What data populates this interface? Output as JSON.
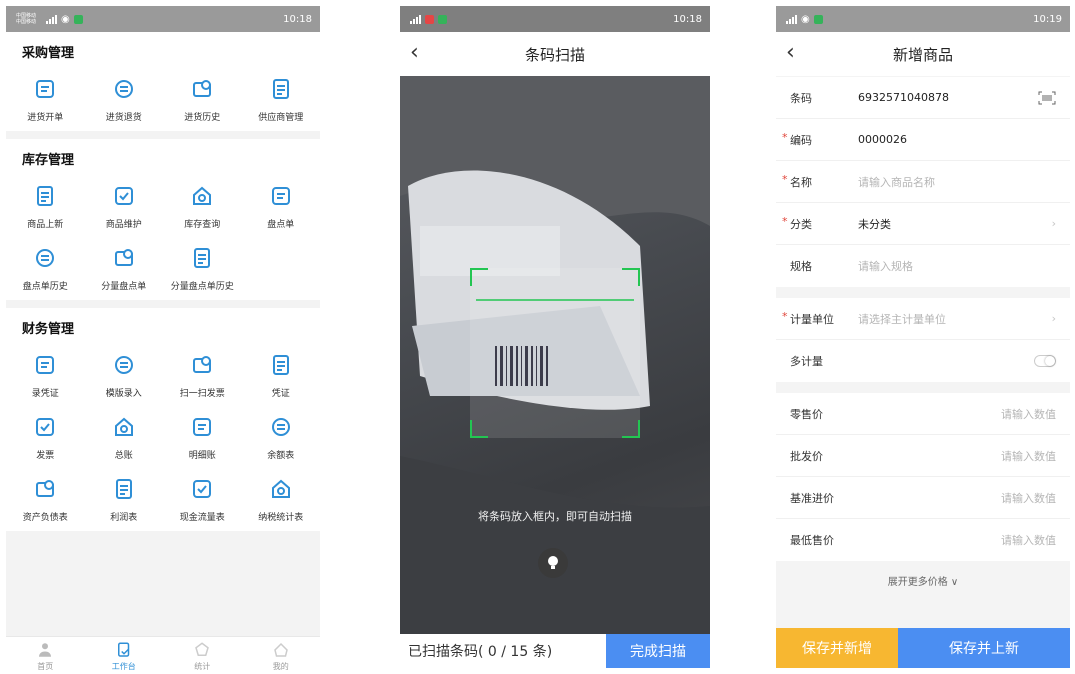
{
  "colors": {
    "accent_blue": "#4b8ef2",
    "accent_yellow": "#f7b731",
    "icon_blue": "#2f8fd6",
    "required_red": "#e0453a"
  },
  "screen1": {
    "status": {
      "carrier": "中国移动\n中国移动",
      "time": "10:18"
    },
    "sections": [
      {
        "title": "采购管理",
        "items": [
          {
            "label": "进货开单",
            "icon": "cart-icon"
          },
          {
            "label": "进货退货",
            "icon": "return-icon"
          },
          {
            "label": "进货历史",
            "icon": "history-icon"
          },
          {
            "label": "供应商管理",
            "icon": "supplier-icon"
          }
        ]
      },
      {
        "title": "库存管理",
        "items": [
          {
            "label": "商品上新",
            "icon": "new-product-icon"
          },
          {
            "label": "商品维护",
            "icon": "product-edit-icon"
          },
          {
            "label": "库存查询",
            "icon": "inventory-search-icon"
          },
          {
            "label": "盘点单",
            "icon": "stocktake-icon"
          },
          {
            "label": "盘点单历史",
            "icon": "stocktake-history-icon"
          },
          {
            "label": "分量盘点单",
            "icon": "partial-stocktake-icon"
          },
          {
            "label": "分量盘点单历史",
            "icon": "partial-history-icon"
          }
        ]
      },
      {
        "title": "财务管理",
        "items": [
          {
            "label": "录凭证",
            "icon": "voucher-entry-icon"
          },
          {
            "label": "模版录入",
            "icon": "template-icon"
          },
          {
            "label": "扫一扫发票",
            "icon": "scan-invoice-icon"
          },
          {
            "label": "凭证",
            "icon": "voucher-icon"
          },
          {
            "label": "发票",
            "icon": "invoice-icon"
          },
          {
            "label": "总账",
            "icon": "ledger-icon"
          },
          {
            "label": "明细账",
            "icon": "detail-ledger-icon"
          },
          {
            "label": "余额表",
            "icon": "balance-icon"
          },
          {
            "label": "资产负债表",
            "icon": "balance-sheet-icon"
          },
          {
            "label": "利润表",
            "icon": "profit-icon"
          },
          {
            "label": "现金流量表",
            "icon": "cashflow-icon"
          },
          {
            "label": "纳税统计表",
            "icon": "tax-stats-icon"
          }
        ]
      }
    ],
    "tabs": [
      {
        "label": "首页",
        "icon": "home-icon"
      },
      {
        "label": "工作台",
        "icon": "workbench-icon"
      },
      {
        "label": "统计",
        "icon": "stats-icon"
      },
      {
        "label": "我的",
        "icon": "profile-icon"
      }
    ]
  },
  "screen2": {
    "status": {
      "time": "10:18"
    },
    "title": "条码扫描",
    "hint": "将条码放入框内，即可自动扫描",
    "scanned_count": "已扫描条码( 0 / 15 条)",
    "done_label": "完成扫描"
  },
  "screen3": {
    "status": {
      "time": "10:19"
    },
    "title": "新增商品",
    "group1": {
      "barcode": {
        "label": "条码",
        "value": "6932571040878"
      },
      "code": {
        "label": "编码",
        "value": "0000026"
      },
      "name": {
        "label": "名称",
        "placeholder": "请输入商品名称"
      },
      "category": {
        "label": "分类",
        "value": "未分类"
      },
      "spec": {
        "label": "规格",
        "placeholder": "请输入规格"
      }
    },
    "group2": {
      "unit": {
        "label": "计量单位",
        "placeholder": "请选择主计量单位"
      },
      "multi": {
        "label": "多计量"
      }
    },
    "group3": {
      "retail": {
        "label": "零售价",
        "placeholder": "请输入数值"
      },
      "wholesale": {
        "label": "批发价",
        "placeholder": "请输入数值"
      },
      "base_cost": {
        "label": "基准进价",
        "placeholder": "请输入数值"
      },
      "min_price": {
        "label": "最低售价",
        "placeholder": "请输入数值"
      }
    },
    "expand_label": "展开更多价格 ∨",
    "save_add_label": "保存并新增",
    "save_list_label": "保存并上新"
  }
}
